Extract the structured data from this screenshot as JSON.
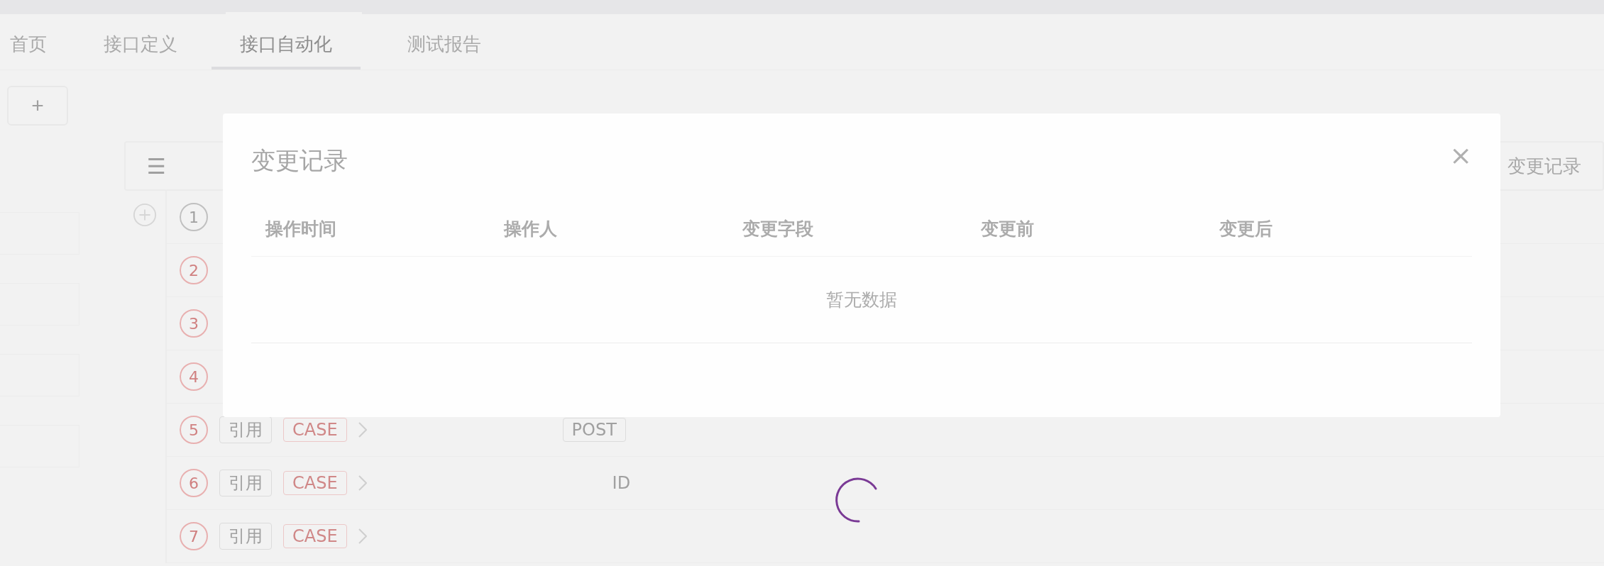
{
  "tabs": [
    {
      "label": "首页",
      "selected": false
    },
    {
      "label": "接口定义",
      "selected": false
    },
    {
      "label": "接口自动化",
      "selected": true
    },
    {
      "label": "测试报告",
      "selected": false
    }
  ],
  "add_button": {
    "label": "+"
  },
  "steps_header": {
    "menu": "☰",
    "change_log_link": "变更记录"
  },
  "steps": [
    {
      "number": "1"
    },
    {
      "number": "2"
    },
    {
      "number": "3"
    },
    {
      "number": "4"
    },
    {
      "number": "5",
      "tag": "引用",
      "type": "CASE",
      "method": "POST"
    },
    {
      "number": "6",
      "tag": "引用",
      "type": "CASE",
      "id_label": "ID"
    },
    {
      "number": "7",
      "tag": "引用",
      "type": "CASE"
    }
  ],
  "dialog": {
    "title": "变更记录",
    "close": "×",
    "columns": [
      "操作时间",
      "操作人",
      "变更字段",
      "变更前",
      "变更后"
    ],
    "empty_text": "暂无数据"
  },
  "loading": true
}
